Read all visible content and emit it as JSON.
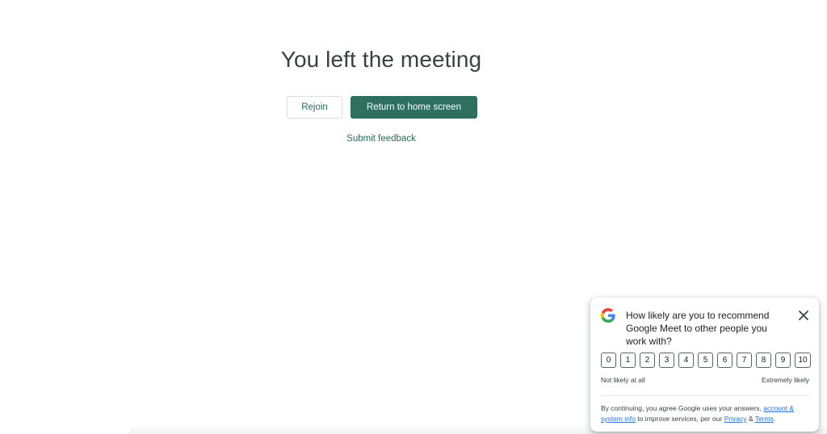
{
  "main": {
    "title": "You left the meeting",
    "rejoin_label": "Rejoin",
    "return_home_label": "Return to home screen",
    "feedback_label": "Submit feedback"
  },
  "survey": {
    "question": "How likely are you to recommend Google Meet to other people you work with?",
    "scale": [
      "0",
      "1",
      "2",
      "3",
      "4",
      "5",
      "6",
      "7",
      "8",
      "9",
      "10"
    ],
    "low_label": "Not likely at all",
    "high_label": "Extremely likely",
    "legal": {
      "prefix": "By continuing, you agree Google uses your answers, ",
      "link_account": "account & system info",
      "middle": " to improve services, per our ",
      "link_privacy": "Privacy",
      "amp": " & ",
      "link_terms": "Terms",
      "suffix": "."
    },
    "icons": {
      "logo": "google-g-icon",
      "close": "close-icon"
    }
  },
  "colors": {
    "accent": "#2e6f60",
    "accent_text": "#2b6b5c",
    "link": "#1a73e8",
    "title": "#3c4043"
  }
}
